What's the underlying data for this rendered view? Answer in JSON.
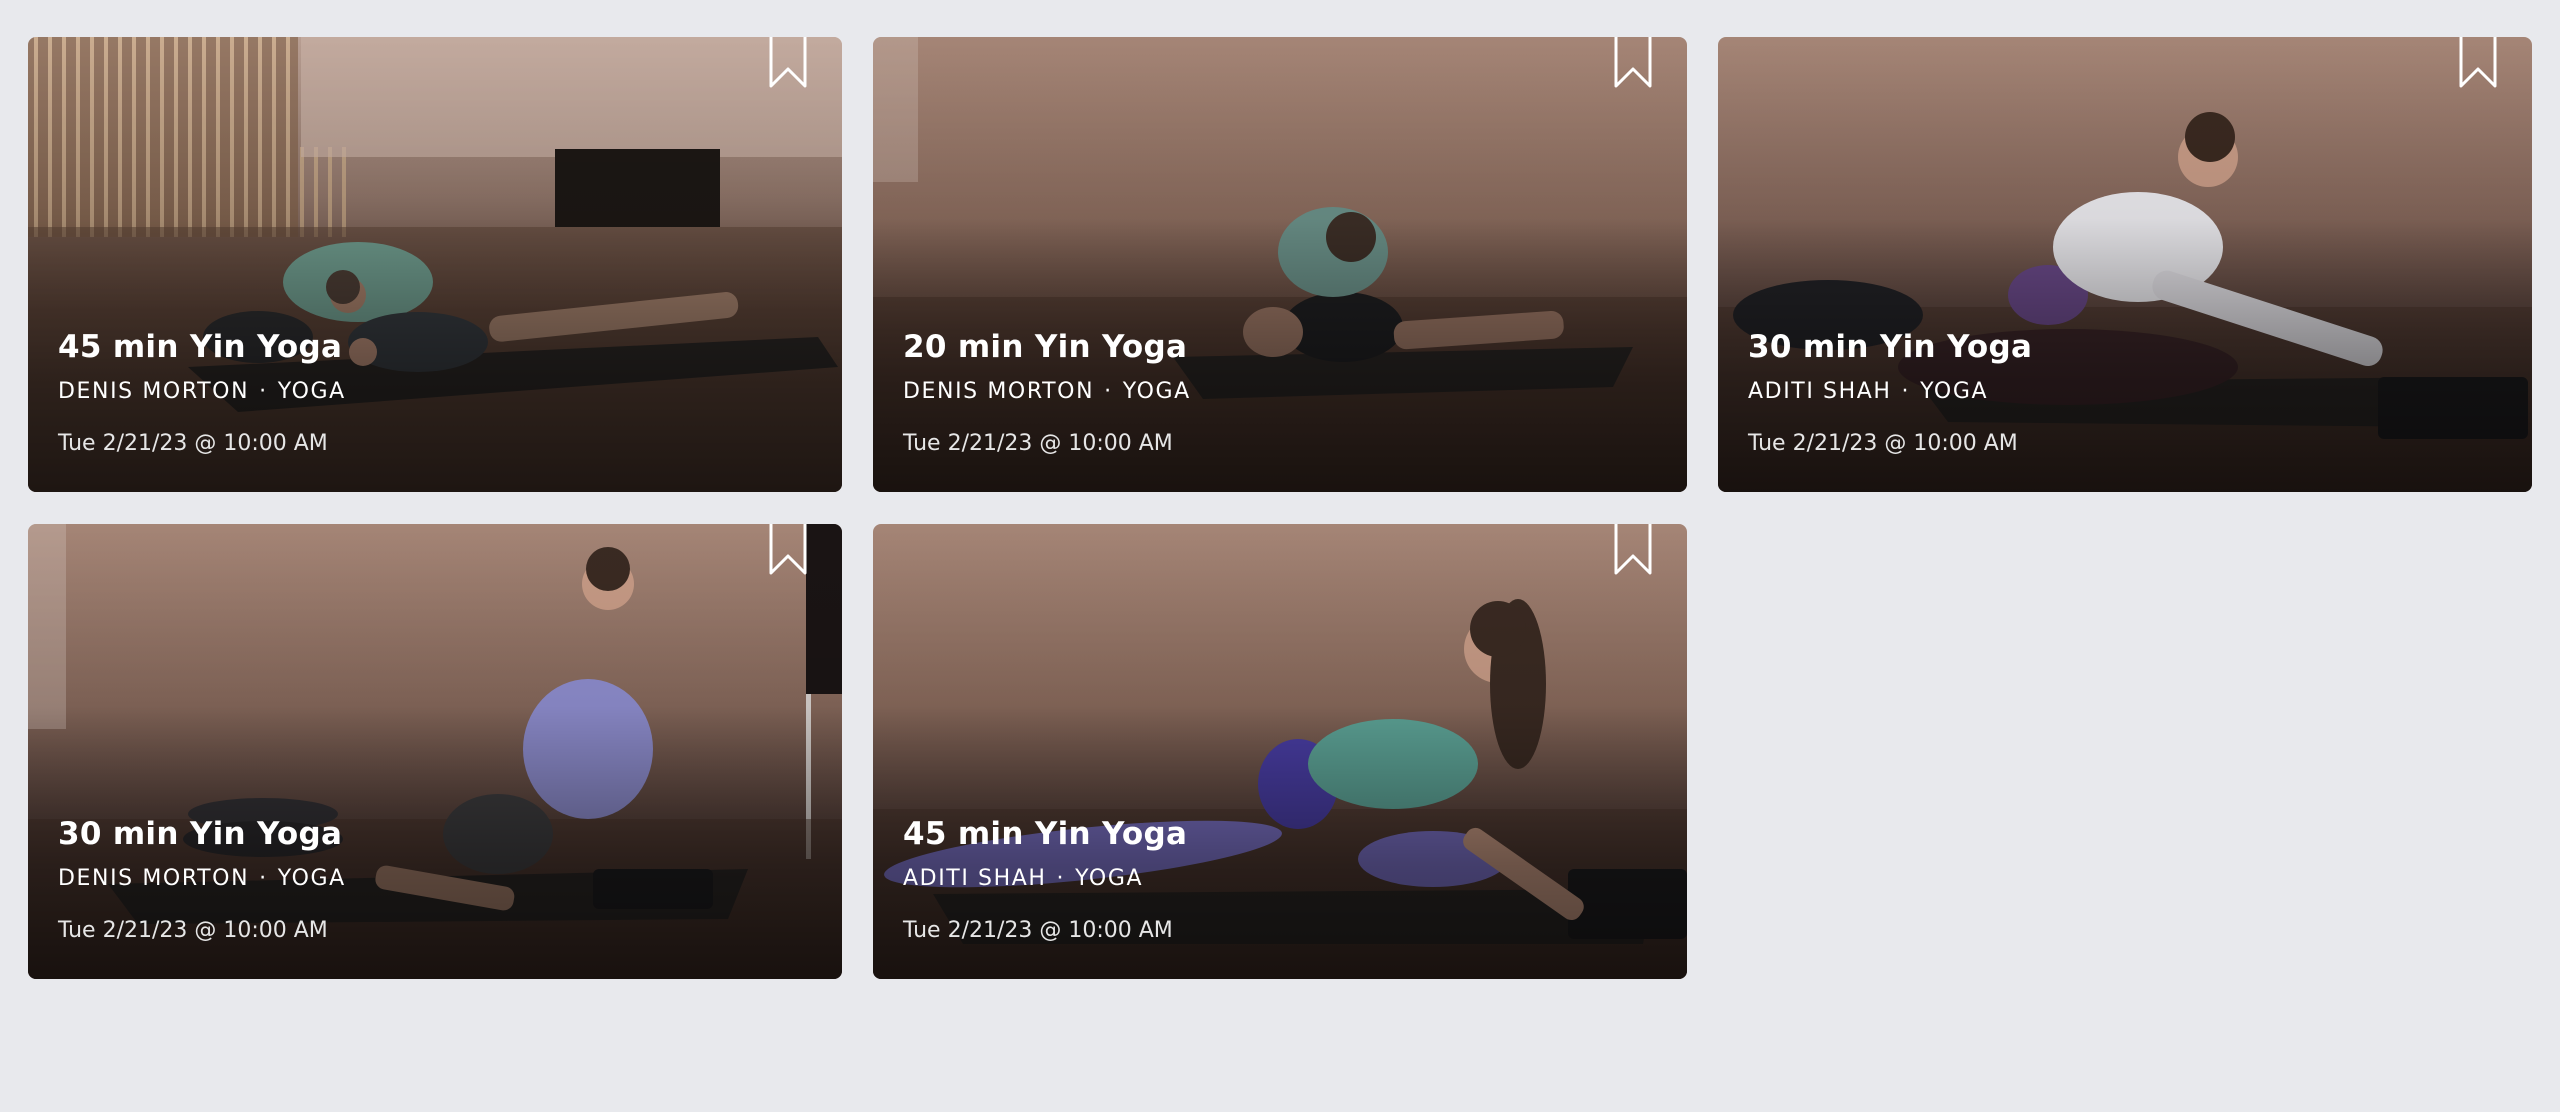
{
  "classes": [
    {
      "title": "45 min Yin Yoga",
      "instructor": "DENIS MORTON",
      "discipline": "YOGA",
      "separator": "·",
      "datetime": "Tue 2/21/23 @ 10:00 AM",
      "bookmark_icon": "bookmark-outline-icon"
    },
    {
      "title": "20 min Yin Yoga",
      "instructor": "DENIS MORTON",
      "discipline": "YOGA",
      "separator": "·",
      "datetime": "Tue 2/21/23 @ 10:00 AM",
      "bookmark_icon": "bookmark-outline-icon"
    },
    {
      "title": "30 min Yin Yoga",
      "instructor": "ADITI SHAH",
      "discipline": "YOGA",
      "separator": "·",
      "datetime": "Tue 2/21/23 @ 10:00 AM",
      "bookmark_icon": "bookmark-outline-icon"
    },
    {
      "title": "30 min Yin Yoga",
      "instructor": "DENIS MORTON",
      "discipline": "YOGA",
      "separator": "·",
      "datetime": "Tue 2/21/23 @ 10:00 AM",
      "bookmark_icon": "bookmark-outline-icon"
    },
    {
      "title": "45 min Yin Yoga",
      "instructor": "ADITI SHAH",
      "discipline": "YOGA",
      "separator": "·",
      "datetime": "Tue 2/21/23 @ 10:00 AM",
      "bookmark_icon": "bookmark-outline-icon"
    }
  ],
  "colors": {
    "page_background": "#e8e9ed",
    "card_text": "#ffffff"
  }
}
